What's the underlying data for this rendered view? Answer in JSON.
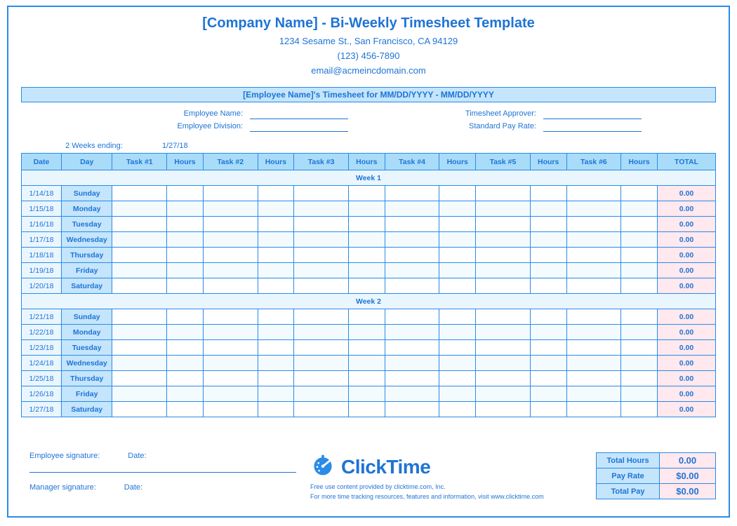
{
  "title": "[Company Name] - Bi-Weekly Timesheet Template",
  "address_line": "1234 Sesame St.,   San Francisco, CA 94129",
  "phone": "(123) 456-7890",
  "email": "email@acmeincdomain.com",
  "banner": "[Employee Name]'s Timesheet for MM/DD/YYYY - MM/DD/YYYY",
  "meta": {
    "emp_name_label": "Employee Name:",
    "emp_div_label": "Employee Division:",
    "approver_label": "Timesheet Approver:",
    "payrate_label": "Standard Pay Rate:"
  },
  "ending_label": "2 Weeks ending:",
  "ending_value": "1/27/18",
  "columns": [
    "Date",
    "Day",
    "Task #1",
    "Hours",
    "Task #2",
    "Hours",
    "Task #3",
    "Hours",
    "Task #4",
    "Hours",
    "Task #5",
    "Hours",
    "Task #6",
    "Hours",
    "TOTAL"
  ],
  "week1_label": "Week 1",
  "week2_label": "Week 2",
  "week1": [
    {
      "date": "1/14/18",
      "day": "Sunday",
      "total": "0.00"
    },
    {
      "date": "1/15/18",
      "day": "Monday",
      "total": "0.00"
    },
    {
      "date": "1/16/18",
      "day": "Tuesday",
      "total": "0.00"
    },
    {
      "date": "1/17/18",
      "day": "Wednesday",
      "total": "0.00"
    },
    {
      "date": "1/18/18",
      "day": "Thursday",
      "total": "0.00"
    },
    {
      "date": "1/19/18",
      "day": "Friday",
      "total": "0.00"
    },
    {
      "date": "1/20/18",
      "day": "Saturday",
      "total": "0.00"
    }
  ],
  "week2": [
    {
      "date": "1/21/18",
      "day": "Sunday",
      "total": "0.00"
    },
    {
      "date": "1/22/18",
      "day": "Monday",
      "total": "0.00"
    },
    {
      "date": "1/23/18",
      "day": "Tuesday",
      "total": "0.00"
    },
    {
      "date": "1/24/18",
      "day": "Wednesday",
      "total": "0.00"
    },
    {
      "date": "1/25/18",
      "day": "Thursday",
      "total": "0.00"
    },
    {
      "date": "1/26/18",
      "day": "Friday",
      "total": "0.00"
    },
    {
      "date": "1/27/18",
      "day": "Saturday",
      "total": "0.00"
    }
  ],
  "summary": {
    "total_hours_label": "Total Hours",
    "total_hours_value": "0.00",
    "pay_rate_label": "Pay Rate",
    "pay_rate_value": "$0.00",
    "total_pay_label": "Total Pay",
    "total_pay_value": "$0.00"
  },
  "sigs": {
    "emp_label": "Employee signature:",
    "mgr_label": "Manager signature:",
    "date_label": "Date:"
  },
  "brand": {
    "name": "ClickTime",
    "line1": "Free use content provided by clicktime.com, Inc.",
    "line2": "For more time tracking resources, features and information, visit www.clicktime.com"
  }
}
